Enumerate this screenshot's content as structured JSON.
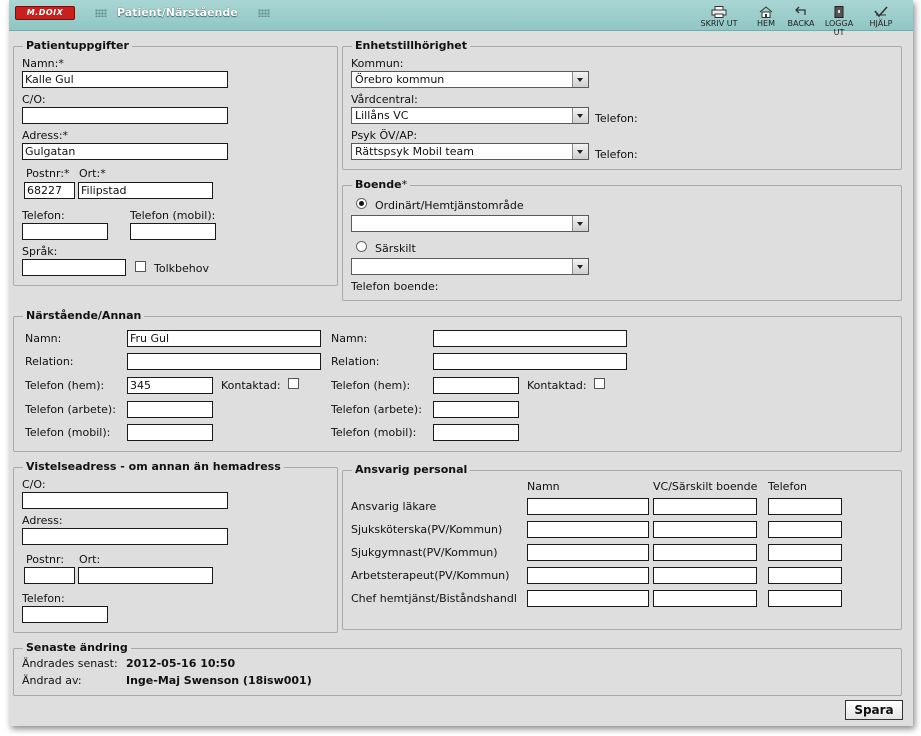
{
  "header": {
    "logo": "M.DOIX",
    "title": "Patient/Närstående",
    "toolbar": [
      {
        "label": "SKRIV UT",
        "icon": "printer-icon"
      },
      {
        "label": "HEM",
        "icon": "home-icon"
      },
      {
        "label": "BACKA",
        "icon": "back-arrow-icon"
      },
      {
        "label": "LOGGA UT",
        "icon": "logout-icon"
      },
      {
        "label": "HJÄLP",
        "icon": "help-check-icon"
      }
    ]
  },
  "patient": {
    "legend": "Patientuppgifter",
    "name_label": "Namn:*",
    "name_value": "Kalle Gul",
    "co_label": "C/O:",
    "co_value": "",
    "address_label": "Adress:*",
    "address_value": "Gulgatan",
    "postnr_label": "Postnr:*",
    "postnr_value": "68227",
    "ort_label": "Ort:*",
    "ort_value": "Filipstad",
    "phone_label": "Telefon:",
    "phone_value": "",
    "mobile_label": "Telefon (mobil):",
    "mobile_value": "",
    "language_label": "Språk:",
    "language_value": "",
    "interpreter_label": "Tolkbehov"
  },
  "unit": {
    "legend": "Enhetstillhörighet",
    "kommun_label": "Kommun:",
    "kommun_value": "Örebro kommun",
    "vardcentral_label": "Vårdcentral:",
    "vardcentral_value": "Lillåns VC",
    "vardcentral_phone_label": "Telefon:",
    "psyk_label": "Psyk ÖV/AP:",
    "psyk_value": "Rättspsyk Mobil team",
    "psyk_phone_label": "Telefon:"
  },
  "housing": {
    "legend": "Boende",
    "legend_star": "*",
    "ordinary_label": "Ordinärt/Hemtjänstområde",
    "ordinary_value": "",
    "special_label": "Särskilt",
    "special_value": "",
    "phone_label": "Telefon boende:"
  },
  "relatives": {
    "legend": "Närstående/Annan",
    "col1": {
      "name_label": "Namn:",
      "name_value": "Fru Gul",
      "relation_label": "Relation:",
      "relation_value": "",
      "home_phone_label": "Telefon (hem):",
      "home_phone_value": "345",
      "contacted_label": "Kontaktad:",
      "work_phone_label": "Telefon (arbete):",
      "work_phone_value": "",
      "mobile_label": "Telefon (mobil):",
      "mobile_value": ""
    },
    "col2": {
      "name_label": "Namn:",
      "name_value": "",
      "relation_label": "Relation:",
      "relation_value": "",
      "home_phone_label": "Telefon (hem):",
      "home_phone_value": "",
      "contacted_label": "Kontaktad:",
      "work_phone_label": "Telefon (arbete):",
      "work_phone_value": "",
      "mobile_label": "Telefon (mobil):",
      "mobile_value": ""
    }
  },
  "visiting": {
    "legend": "Vistelseadress - om annan än hemadress",
    "co_label": "C/O:",
    "co_value": "",
    "address_label": "Adress:",
    "address_value": "",
    "postnr_label": "Postnr:",
    "postnr_value": "",
    "ort_label": "Ort:",
    "ort_value": "",
    "phone_label": "Telefon:",
    "phone_value": ""
  },
  "staff": {
    "legend": "Ansvarig personal",
    "col_name": "Namn",
    "col_unit": "VC/Särskilt boende",
    "col_phone": "Telefon",
    "rows": [
      {
        "role": "Ansvarig läkare"
      },
      {
        "role": "Sjuksköterska(PV/Kommun)"
      },
      {
        "role": "Sjukgymnast(PV/Kommun)"
      },
      {
        "role": "Arbetsterapeut(PV/Kommun)"
      },
      {
        "role": "Chef hemtjänst/Biståndshandl"
      }
    ]
  },
  "last_change": {
    "legend": "Senaste ändring",
    "changed_label": "Ändrades senast:",
    "changed_value": "2012-05-16 10:50",
    "by_label": "Ändrad av:",
    "by_value": "Inge-Maj Swenson (18isw001)"
  },
  "actions": {
    "save_label": "Spara"
  }
}
